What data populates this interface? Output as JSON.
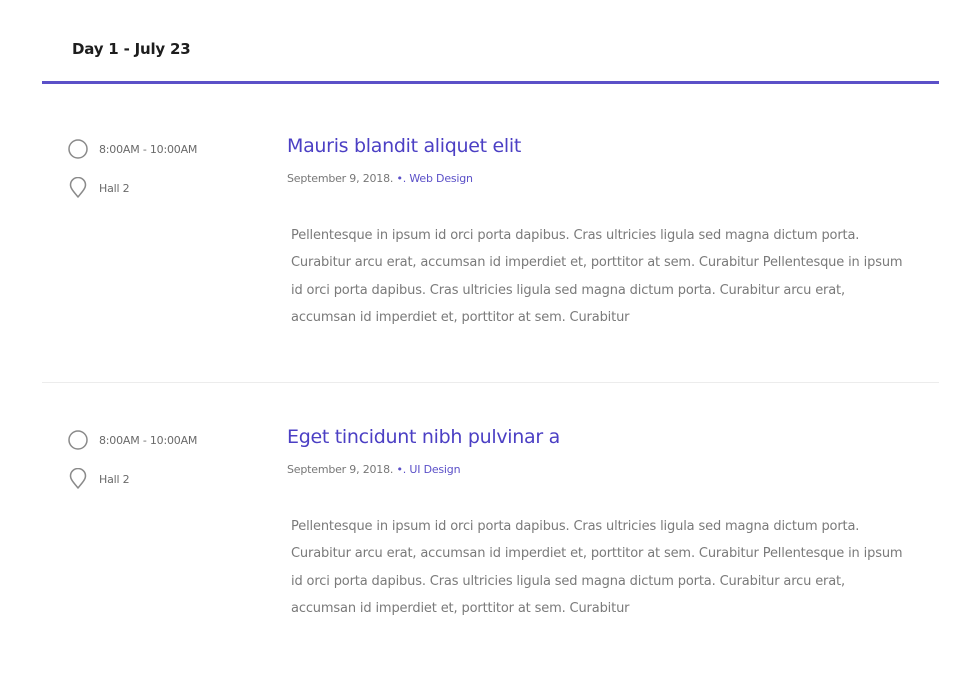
{
  "day": {
    "label": "Day 1 - July 23"
  },
  "sessions": [
    {
      "time": "8:00AM - 10:00AM",
      "location": "Hall 2",
      "title": "Mauris blandit aliquet elit",
      "date": "September 9, 2018.",
      "separator": "•.",
      "category": "Web Design",
      "description": "Pellentesque in ipsum id orci porta dapibus. Cras ultricies ligula sed magna dictum porta. Curabitur arcu erat, accumsan id imperdiet et, porttitor at sem. Curabitur  Pellentesque in ipsum id orci porta dapibus. Cras ultricies ligula sed magna dictum porta. Curabitur arcu erat, accumsan id imperdiet et, porttitor at sem. Curabitur"
    },
    {
      "time": "8:00AM - 10:00AM",
      "location": "Hall 2",
      "title": "Eget tincidunt nibh pulvinar a",
      "date": "September 9, 2018.",
      "separator": "•.",
      "category": "UI Design",
      "description": "Pellentesque in ipsum id orci porta dapibus. Cras ultricies ligula sed magna dictum porta. Curabitur arcu erat, accumsan id imperdiet et, porttitor at sem. Curabitur  Pellentesque in ipsum id orci porta dapibus. Cras ultricies ligula sed magna dictum porta. Curabitur arcu erat, accumsan id imperdiet et, porttitor at sem. Curabitur"
    }
  ],
  "icons": {
    "time": "clock-icon",
    "location": "map-pin-icon"
  },
  "colors": {
    "accent": "#5b50c8",
    "title": "#4b3fc4",
    "body_text": "#7a7a7a",
    "divider": "#ececec"
  }
}
